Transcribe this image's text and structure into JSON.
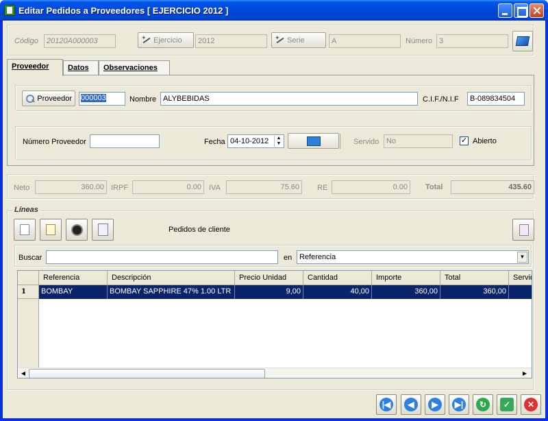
{
  "window": {
    "title": "Editar Pedidos a Proveedores [ EJERCICIO 2012 ]"
  },
  "header": {
    "codigo_label": "Código",
    "codigo_value": "20120A000003",
    "ejercicio_button": "Ejercicio",
    "ejercicio_value": "2012",
    "serie_button": "Serie",
    "serie_value": "A",
    "numero_label": "Número",
    "numero_value": "3"
  },
  "tabs": [
    {
      "label": "Proveedor",
      "accel": "P",
      "active": true
    },
    {
      "label": "Datos",
      "accel": "D"
    },
    {
      "label": "Observaciones",
      "accel": "O"
    }
  ],
  "proveedor": {
    "button": "Proveedor",
    "code": "000003",
    "nombre_label": "Nombre",
    "nombre_value": "ALYBEBIDAS",
    "cif_label": "C.I.F./N.I.F",
    "cif_value": "B-089834504",
    "numero_proveedor_label": "Número Proveedor",
    "numero_proveedor_value": "",
    "fecha_label": "Fecha",
    "fecha_value": "04-10-2012",
    "servido_label": "Servido",
    "servido_value": "No",
    "abierto_label": "Abierto",
    "abierto_checked": true
  },
  "totals": {
    "neto_label": "Neto",
    "neto": "360.00",
    "irpf_label": "IRPF",
    "irpf": "0.00",
    "iva_label": "IVA",
    "iva": "75.60",
    "re_label": "RE",
    "re": "0.00",
    "total_label": "Total",
    "total": "435.60"
  },
  "lineas": {
    "title": "Líneas",
    "pedidos_cliente_label": "Pedidos de cliente",
    "buscar_label": "Buscar",
    "buscar_value": "",
    "en_label": "en",
    "en_value": "Referencia",
    "columns": [
      "Referencia",
      "Descripción",
      "Precio Unidad",
      "Cantidad",
      "Importe",
      "Total",
      "Servido"
    ],
    "rows": [
      {
        "n": "1",
        "referencia": "BOMBAY",
        "descripcion": "BOMBAY SAPPHIRE 47% 1.00 LTR",
        "precio": "9,00",
        "cantidad": "40,00",
        "importe": "360,00",
        "total": "360,00"
      }
    ]
  },
  "icons": {
    "nav": [
      "first-icon",
      "prev-icon",
      "next-icon",
      "last-icon",
      "refresh-icon",
      "save-icon",
      "cancel-icon"
    ]
  },
  "colors": {
    "titlebar": "#0054e3",
    "selection": "#0a246a",
    "face": "#ece9d8"
  }
}
